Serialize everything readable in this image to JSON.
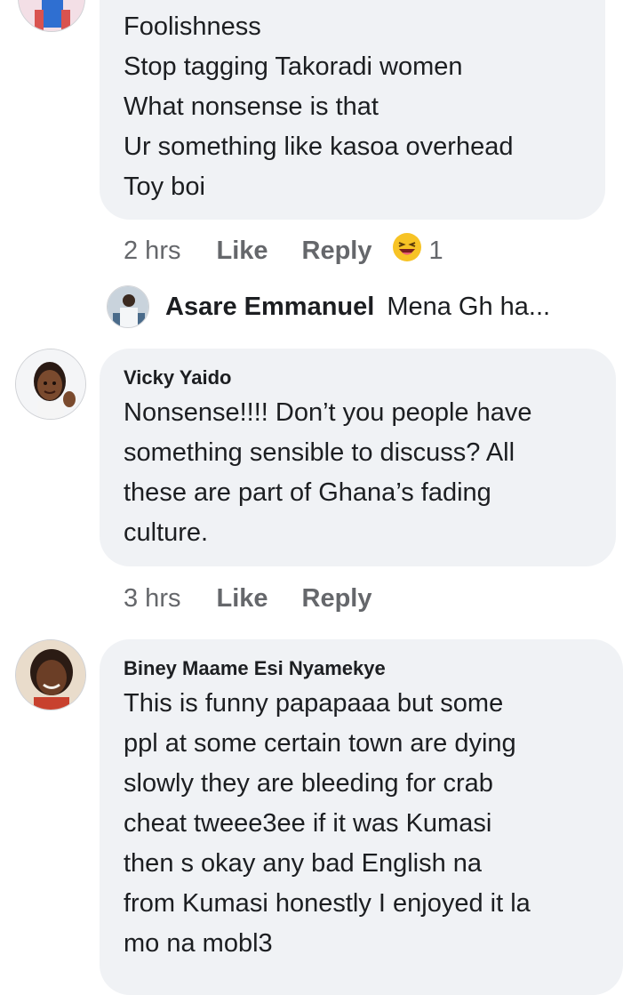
{
  "comments": [
    {
      "author": "",
      "lines": "Foolishness\nStop tagging Takoradi women\nWhat nonsense is that\nUr something like kasoa overhead\nToy boi",
      "time": "2 hrs",
      "like_label": "Like",
      "reply_label": "Reply",
      "reaction_icon": "laughing-emoji-icon",
      "reaction_count": "1"
    },
    {
      "author": "Vicky Yaido",
      "lines": "Nonsense!!!! Don’t you people have\nsomething sensible to discuss? All\nthese are part of Ghana’s fading\nculture.",
      "time": "3 hrs",
      "like_label": "Like",
      "reply_label": "Reply"
    },
    {
      "author": "Biney Maame Esi Nyamekye",
      "lines": "This is funny papapaaa but some\nppl at some certain town are dying\nslowly they are bleeding for crab\ncheat tweee3ee  if it was Kumasi\nthen s okay any bad English na\nfrom Kumasi honestly I enjoyed it la\nmo na mobl3"
    }
  ],
  "reply_preview": {
    "author": "Asare Emmanuel",
    "snippet": "Mena Gh ha..."
  },
  "colors": {
    "bubble": "#f0f2f5",
    "meta": "#65676b",
    "text": "#1c1e21",
    "emoji": "#f7c325"
  }
}
